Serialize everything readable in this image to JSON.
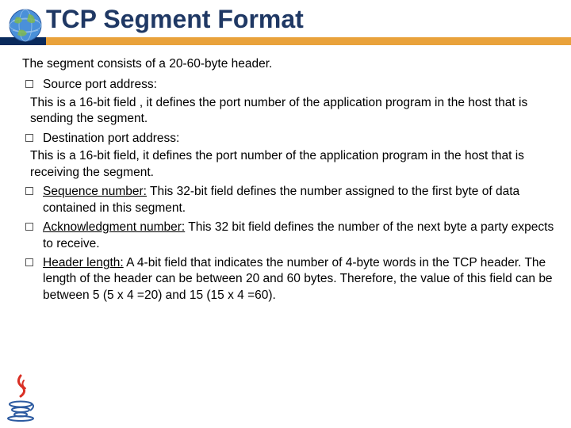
{
  "title": "TCP Segment Format",
  "intro": "The segment consists of a 20-60-byte header.",
  "items": [
    {
      "label": "Source port address:",
      "text": "This is a 16-bit field , it defines the port number of the application program in the host that is sending the segment."
    },
    {
      "label": "Destination port address:",
      "text": "This is a 16-bit field, it defines the port number of the application program in the host that is receiving the segment."
    },
    {
      "label": "Sequence number:",
      "inline": " This 32-bit field defines the number assigned to the first byte of data contained in this segment."
    },
    {
      "label": "Acknowledgment number:",
      "inline": " This 32 bit field defines the number of the next byte a party expects to receive."
    },
    {
      "label": "Header length:",
      "inline": " A 4-bit field that indicates the number of 4-byte words in the TCP header. The length of the header can be between 20 and 60 bytes. Therefore, the value of this field can be between 5 (5 x 4 =20) and 15 (15 x 4 =60)."
    }
  ],
  "icons": {
    "globe": "globe-icon",
    "java": "java-logo"
  }
}
